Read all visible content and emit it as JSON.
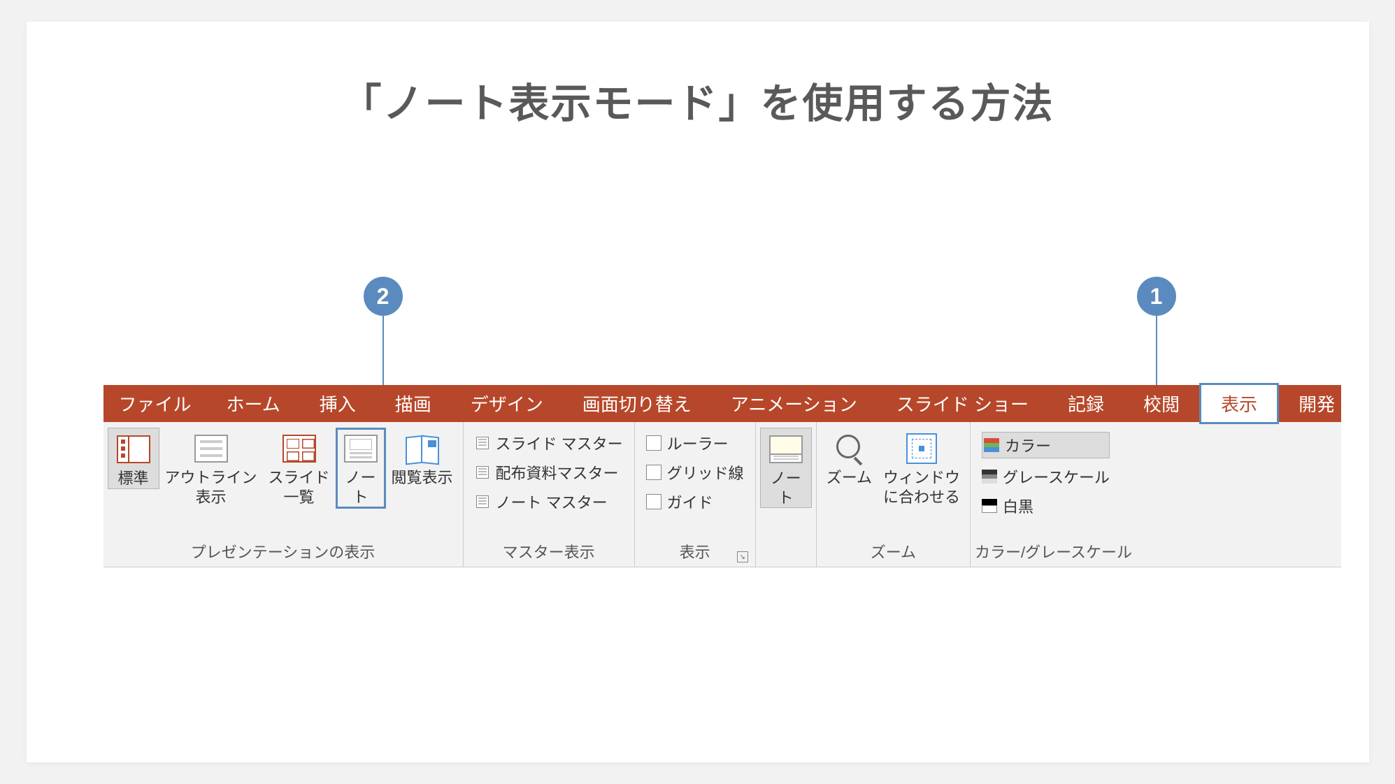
{
  "title": "「ノート表示モード」を使用する方法",
  "callouts": {
    "one": "1",
    "two": "2"
  },
  "tabs": {
    "file": "ファイル",
    "home": "ホーム",
    "insert": "挿入",
    "draw": "描画",
    "design": "デザイン",
    "transition": "画面切り替え",
    "animation": "アニメーション",
    "slideshow": "スライド ショー",
    "record": "記録",
    "review": "校閲",
    "view": "表示",
    "developer": "開発"
  },
  "groups": {
    "presentation_views": {
      "label": "プレゼンテーションの表示",
      "normal": "標準",
      "outline": "アウトライン\n表示",
      "sorter": "スライド\n一覧",
      "notes": "ノー\nト",
      "reading": "閲覧表示"
    },
    "master_views": {
      "label": "マスター表示",
      "slide_master": "スライド マスター",
      "handout_master": "配布資料マスター",
      "notes_master": "ノート マスター"
    },
    "show": {
      "label": "表示",
      "ruler": "ルーラー",
      "gridlines": "グリッド線",
      "guides": "ガイド"
    },
    "notes_pane": {
      "notes": "ノー\nト"
    },
    "zoom": {
      "label": "ズーム",
      "zoom": "ズーム",
      "fit": "ウィンドウ\nに合わせる"
    },
    "color_grayscale": {
      "label": "カラー/グレースケール",
      "color": "カラー",
      "grayscale": "グレースケール",
      "bw": "白黒"
    }
  }
}
